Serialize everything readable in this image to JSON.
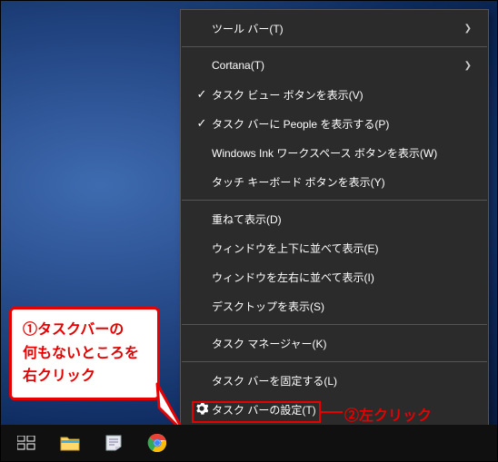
{
  "context_menu": {
    "items": [
      {
        "label": "ツール バー(T)",
        "has_submenu": true,
        "checked": false
      },
      {
        "sep": true
      },
      {
        "label": "Cortana(T)",
        "has_submenu": true,
        "checked": false
      },
      {
        "label": "タスク ビュー ボタンを表示(V)",
        "has_submenu": false,
        "checked": true
      },
      {
        "label": "タスク バーに People を表示する(P)",
        "has_submenu": false,
        "checked": true
      },
      {
        "label": "Windows Ink ワークスペース ボタンを表示(W)",
        "has_submenu": false,
        "checked": false
      },
      {
        "label": "タッチ キーボード ボタンを表示(Y)",
        "has_submenu": false,
        "checked": false
      },
      {
        "sep": true
      },
      {
        "label": "重ねて表示(D)",
        "has_submenu": false,
        "checked": false
      },
      {
        "label": "ウィンドウを上下に並べて表示(E)",
        "has_submenu": false,
        "checked": false
      },
      {
        "label": "ウィンドウを左右に並べて表示(I)",
        "has_submenu": false,
        "checked": false
      },
      {
        "label": "デスクトップを表示(S)",
        "has_submenu": false,
        "checked": false
      },
      {
        "sep": true
      },
      {
        "label": "タスク マネージャー(K)",
        "has_submenu": false,
        "checked": false
      },
      {
        "sep": true
      },
      {
        "label": "タスク バーを固定する(L)",
        "has_submenu": false,
        "checked": false
      },
      {
        "label": "タスク バーの設定(T)",
        "has_submenu": false,
        "checked": false,
        "icon": "gear"
      }
    ]
  },
  "annotations": {
    "callout1_line1": "①タスクバーの",
    "callout1_line2": "何もないところを",
    "callout1_line3": "右クリック",
    "callout2": "②左クリック"
  },
  "taskbar": {
    "items": [
      "task-view",
      "file-explorer",
      "sticky-notes",
      "chrome"
    ]
  },
  "colors": {
    "highlight": "#e60000",
    "menu_bg": "#2b2b2b"
  }
}
